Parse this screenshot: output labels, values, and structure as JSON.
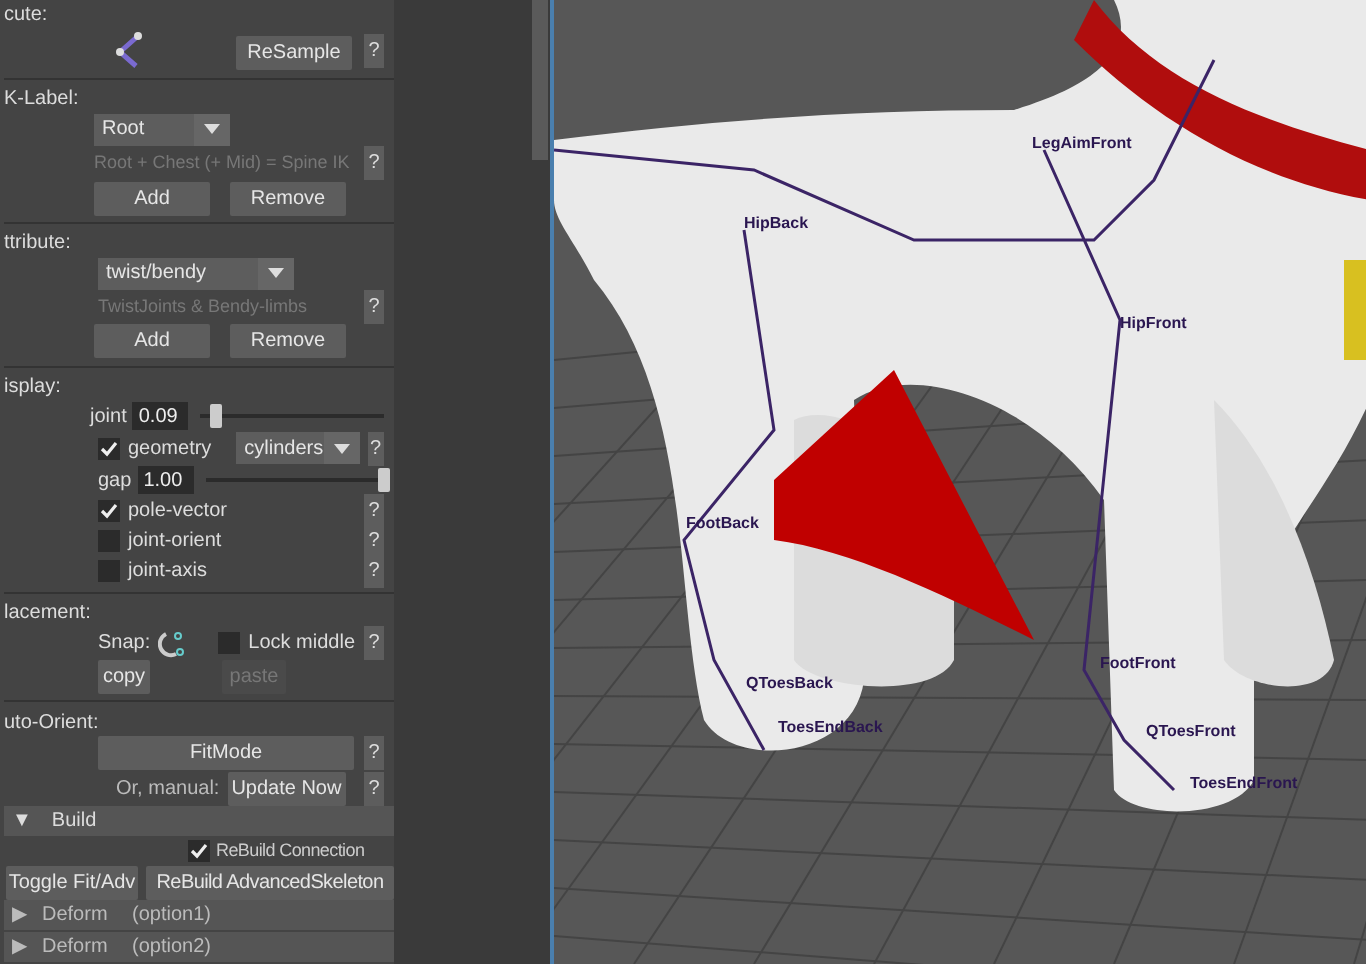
{
  "panel": {
    "resample": {
      "label": "cute:",
      "button": "ReSample",
      "help": "?"
    },
    "ik_label": {
      "label": "K-Label:",
      "dropdown": "Root",
      "hint": "Root + Chest (+ Mid) = Spine IK",
      "help": "?",
      "add": "Add",
      "remove": "Remove"
    },
    "attribute": {
      "label": "ttribute:",
      "dropdown": "twist/bendy",
      "hint": "TwistJoints & Bendy-limbs",
      "help": "?",
      "add": "Add",
      "remove": "Remove"
    },
    "display": {
      "label": "isplay:",
      "joint": {
        "label": "joint",
        "value": "0.09",
        "level": 0.05
      },
      "geometry": {
        "label": "geometry",
        "checked": true,
        "dropdown": "cylinders",
        "help": "?"
      },
      "gap": {
        "label": "gap",
        "value": "1.00",
        "level": 1
      },
      "toggles": [
        {
          "label": "pole-vector",
          "checked": true,
          "help": "?"
        },
        {
          "label": "joint-orient",
          "checked": false,
          "help": "?"
        },
        {
          "label": "joint-axis",
          "checked": false,
          "help": "?"
        }
      ]
    },
    "placement": {
      "label": "lacement:",
      "snap": "Snap:",
      "lock": {
        "label": "Lock middle",
        "checked": false
      },
      "help": "?",
      "copy": {
        "label": "copy",
        "disabled": false
      },
      "paste": {
        "label": "paste",
        "disabled": true
      }
    },
    "auto_orient": {
      "label": "uto-Orient:",
      "fit": "FitMode",
      "help": "?",
      "manual": "Or, manual:",
      "update": "Update Now",
      "help2": "?"
    },
    "build": {
      "arrow": "▼",
      "title": "Build",
      "expanded": true,
      "rebuild_connections": {
        "label": "ReBuild Connection",
        "checked": true
      },
      "toggle": "Toggle Fit/Adv",
      "rebuild": "ReBuild AdvancedSkeleton"
    },
    "collapsed": [
      {
        "arrow": "▶",
        "title": "Deform",
        "option": "(option1)"
      },
      {
        "arrow": "▶",
        "title": "Deform",
        "option": "(option2)"
      }
    ]
  },
  "viewport": {
    "joints": [
      "LegAimFront",
      "HipBack",
      "HipFront",
      "FootBack",
      "FootFront",
      "QToesBack",
      "ToesEndBack",
      "QToesFront",
      "ToesEndFront"
    ]
  }
}
